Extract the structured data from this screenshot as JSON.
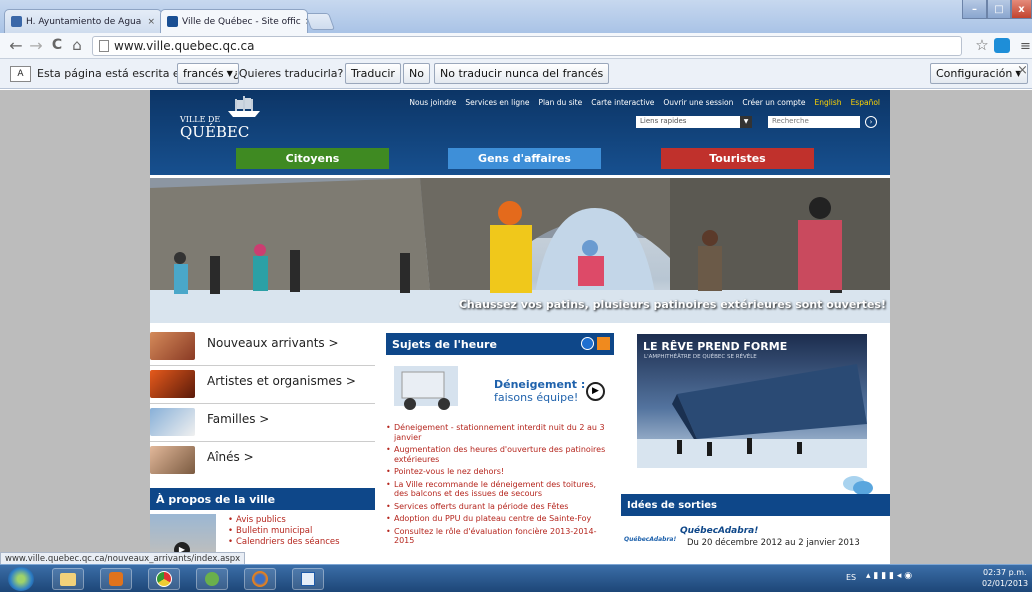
{
  "tabs": [
    {
      "label": "H. Ayuntamiento de Agua",
      "close": "×"
    },
    {
      "label": "Ville de Québec - Site offic",
      "close": "×"
    }
  ],
  "window_controls": {
    "minimize": "–",
    "maximize": "□",
    "close": "x"
  },
  "toolbar": {
    "back": "←",
    "forward": "→",
    "reload": "C",
    "home": "⌂",
    "url": "www.ville.quebec.qc.ca",
    "star": "☆"
  },
  "translate_bar": {
    "message": "Esta página está escrita en",
    "language": "francés",
    "question": "¿Quieres traducirla?",
    "translate_label": "Traducir",
    "no_label": "No",
    "never_label": "No traducir nunca del francés",
    "settings_label": "Configuración"
  },
  "site": {
    "logo_line1": "VILLE DE",
    "logo_line2": "QUÉBEC",
    "top_links": [
      "Nous joindre",
      "Services en ligne",
      "Plan du site",
      "Carte interactive",
      "Ouvrir une session",
      "Créer un compte"
    ],
    "lang_en": "English",
    "lang_es": "Español",
    "quick_links_label": "Liens rapides",
    "search_placeholder": "Recherche",
    "categories": [
      "Citoyens",
      "Gens d'affaires",
      "Touristes"
    ],
    "hero_caption": "Chaussez vos patins, plusieurs patinoires extérieures sont ouvertes!",
    "left_items": [
      "Nouveaux arrivants >",
      "Artistes et organismes >",
      "Familles >",
      "Aînés >"
    ],
    "about_title": "À propos de la ville",
    "about_links": [
      "Avis publics",
      "Bulletin municipal",
      "Calendriers des séances"
    ],
    "sujets_title": "Sujets de l'heure",
    "deneigement_line1": "Déneigement :",
    "deneigement_line2": "faisons équipe!",
    "news": [
      "Déneigement - stationnement interdit nuit du 2 au 3 janvier",
      "Augmentation des heures d'ouverture des patinoires extérieures",
      "Pointez-vous le nez dehors!",
      "La Ville recommande le déneigement des toitures, des balcons et des issues de secours",
      "Services offerts durant la période des Fêtes",
      "Adoption du PPU du plateau centre de Sainte-Foy",
      "Consultez le rôle d'évaluation foncière 2013-2014-2015"
    ],
    "reve_title": "LE RÊVE PREND FORME",
    "reve_sub": "L'AMPHITHÉÂTRE DE QUÉBEC SE RÉVÈLE",
    "idees_title": "Idées de sorties",
    "event_logo": "QuébecAdabra!",
    "event_title": "QuébecAdabra!",
    "event_dates": "Du 20 décembre 2012 au 2 janvier 2013"
  },
  "status_url": "www.ville.quebec.qc.ca/nouveaux_arrivants/index.aspx",
  "tray": {
    "lang": "ES",
    "time": "02:37 p.m.",
    "date": "02/01/2013"
  },
  "colors": {
    "site_blue": "#0e4789",
    "citoyens": "#3f8a22",
    "affaires": "#3e8fd8",
    "touristes": "#c0312c",
    "link_red": "#b5261e"
  }
}
